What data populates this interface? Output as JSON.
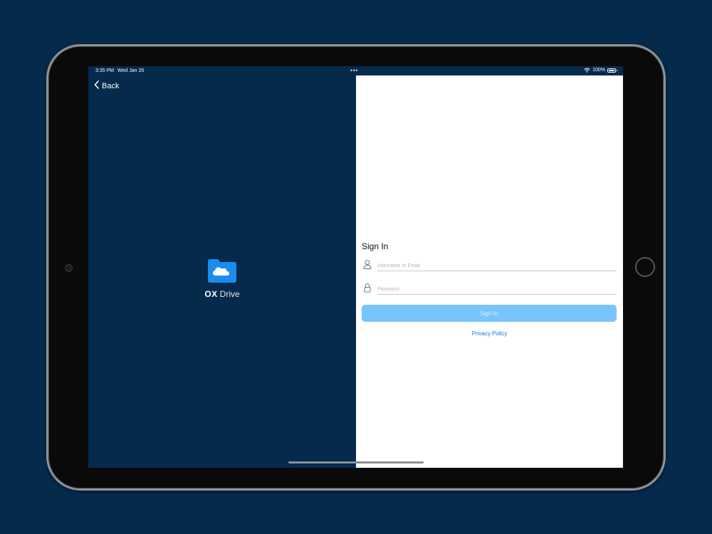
{
  "status_bar": {
    "time": "3:35 PM",
    "date": "Wed Jan 26",
    "dots": "•••",
    "battery_percent": "100%",
    "wifi_icon": "wifi-icon",
    "battery_icon": "battery-icon"
  },
  "nav": {
    "back_label": "Back",
    "back_icon": "chevron-left-icon"
  },
  "brand": {
    "logo_icon": "cloud-folder-icon",
    "name_ox": "OX",
    "name_product": "Drive"
  },
  "sign_in": {
    "title": "Sign In",
    "username_placeholder": "Username or Email",
    "username_value": "",
    "password_placeholder": "Password",
    "password_value": "",
    "button_label": "Sign In",
    "privacy_link": "Privacy Policy"
  },
  "colors": {
    "background": "#052a4c",
    "accent": "#0a7ae6",
    "button_disabled": "#78c5fd",
    "logo_blue": "#1a8cf0"
  }
}
